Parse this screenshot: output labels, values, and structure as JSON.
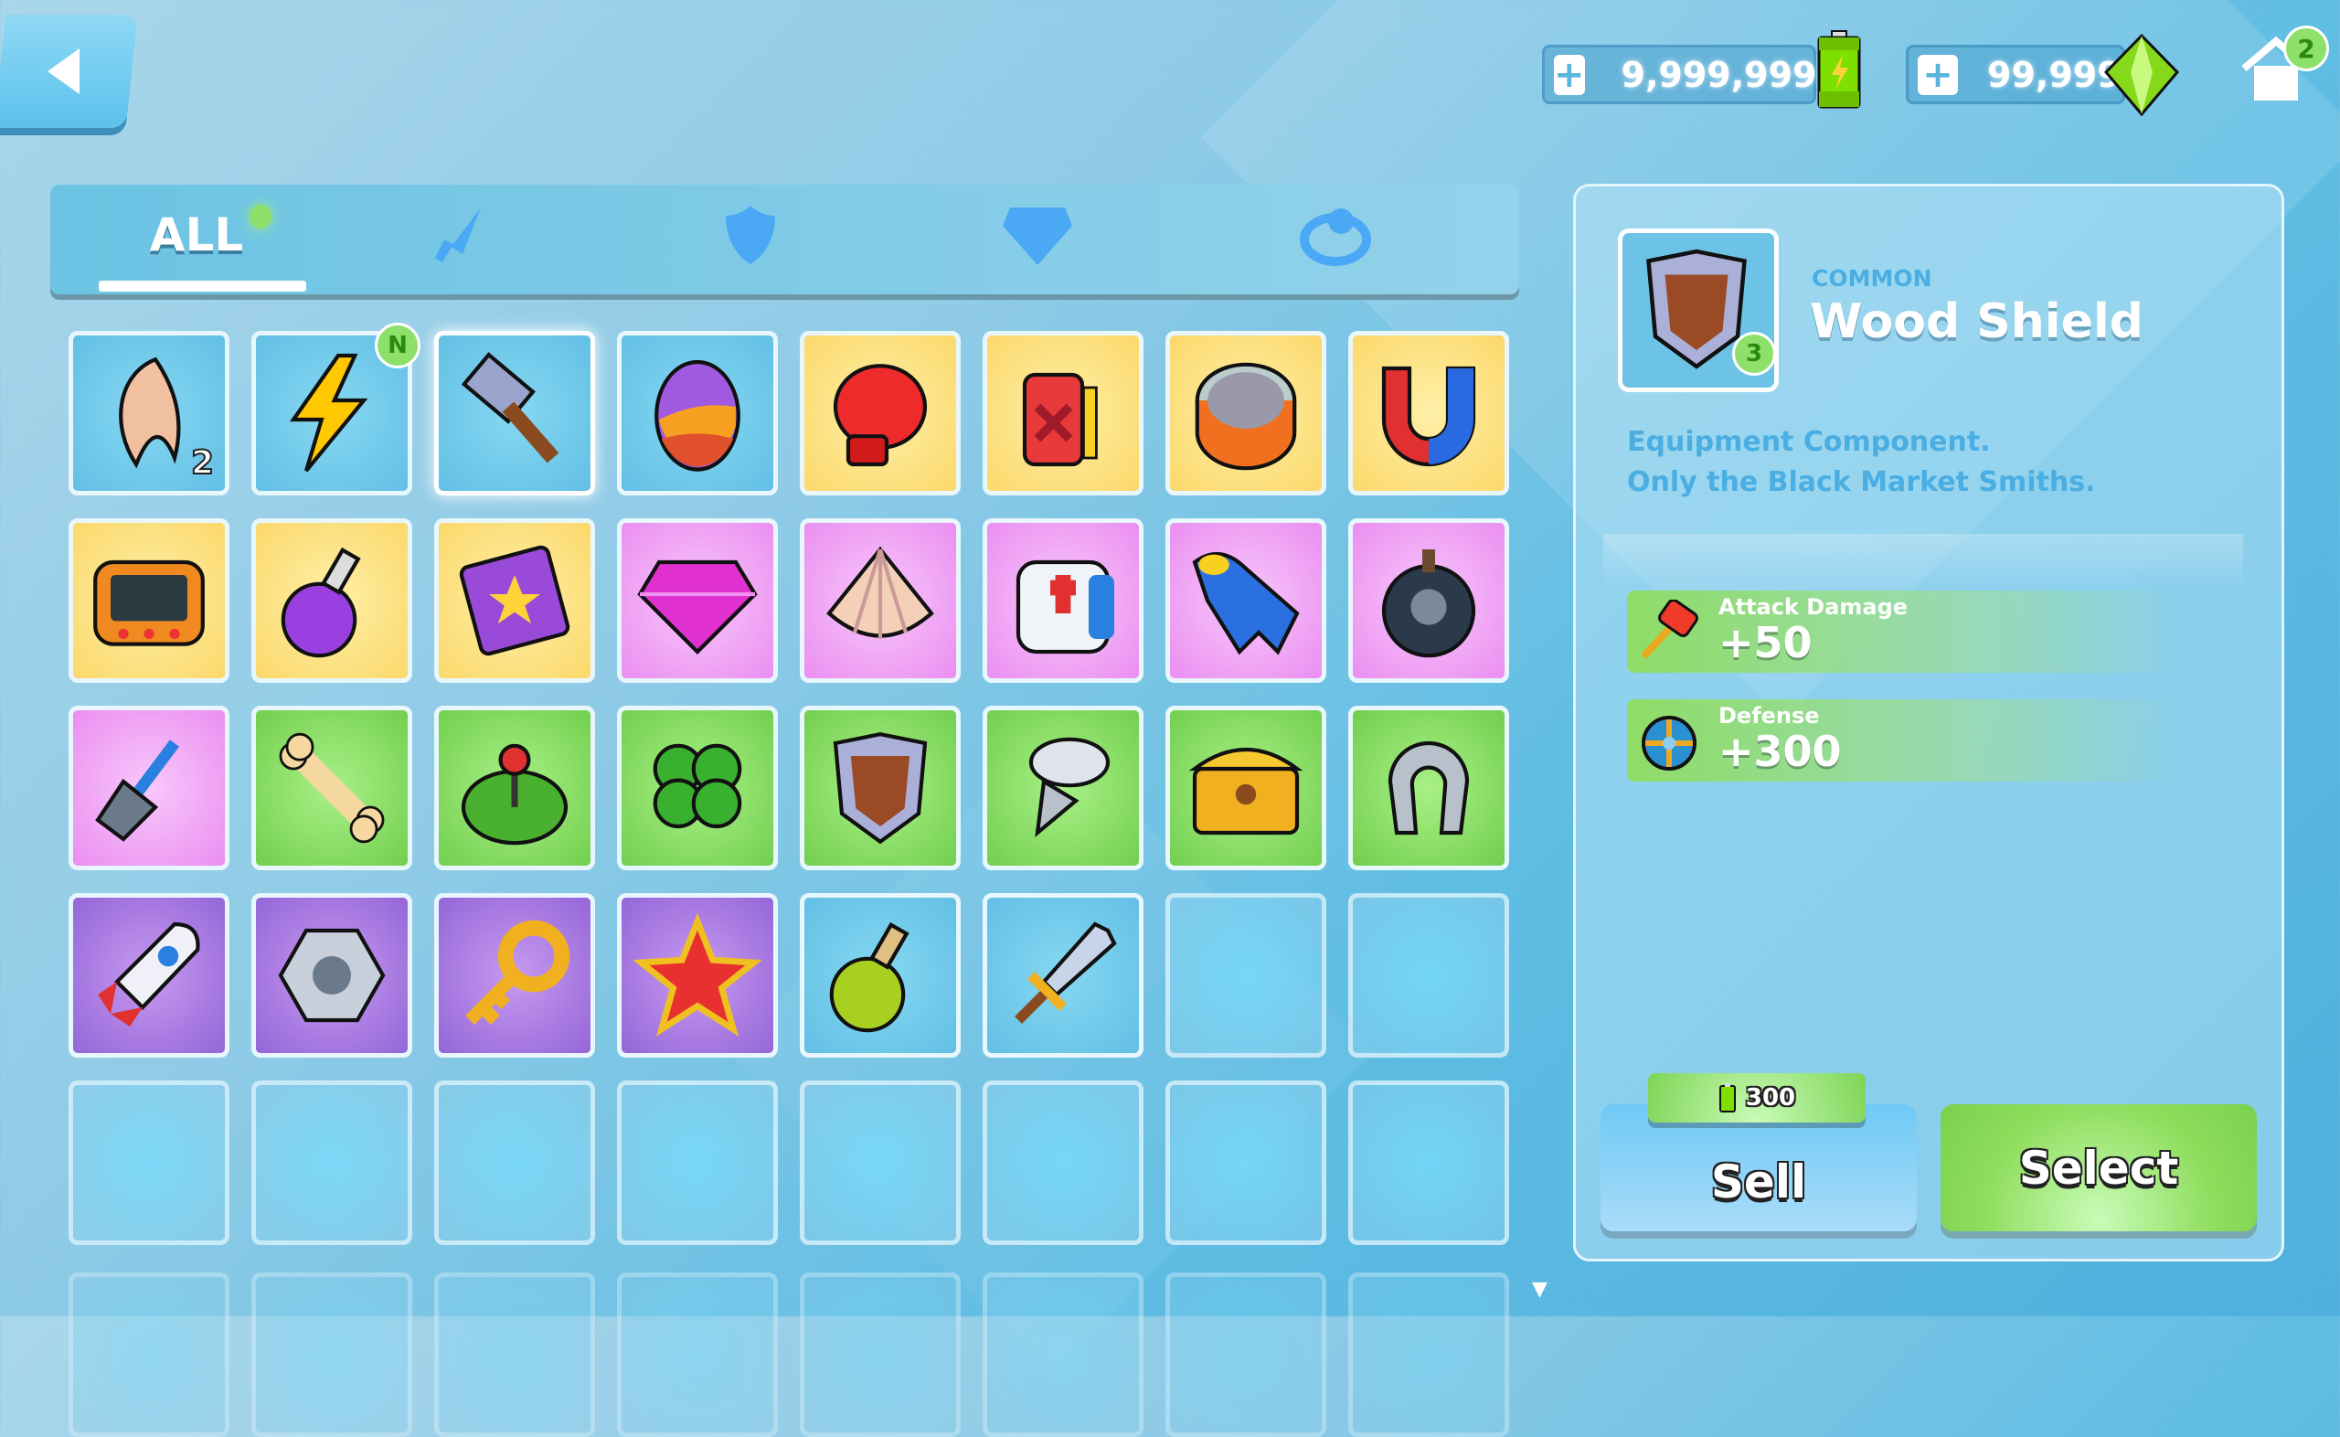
{
  "header": {
    "energy": "9,999,999",
    "gems": "99,999",
    "home_badge": "2"
  },
  "tabs": [
    {
      "label": "ALL",
      "icon": "all"
    },
    {
      "icon": "sword-icon"
    },
    {
      "icon": "shield-icon"
    },
    {
      "icon": "gem-icon"
    },
    {
      "icon": "ring-icon"
    }
  ],
  "grid": [
    [
      {
        "icon": "fang",
        "bg": "blue",
        "qty": "2"
      },
      {
        "icon": "lightning",
        "bg": "blue",
        "badge": "N"
      },
      {
        "icon": "hammer",
        "bg": "blue",
        "selected": true
      },
      {
        "icon": "rainbow-egg",
        "bg": "blue"
      },
      {
        "icon": "boxing-glove",
        "bg": "yellow"
      },
      {
        "icon": "fuel-can",
        "bg": "yellow"
      },
      {
        "icon": "tin-can",
        "bg": "yellow"
      },
      {
        "icon": "magnet",
        "bg": "yellow"
      }
    ],
    [
      {
        "icon": "handheld-console",
        "bg": "yellow"
      },
      {
        "icon": "potion-purple",
        "bg": "yellow"
      },
      {
        "icon": "spell-book",
        "bg": "yellow"
      },
      {
        "icon": "diamond",
        "bg": "pink"
      },
      {
        "icon": "seashell",
        "bg": "pink"
      },
      {
        "icon": "medkit-backpack",
        "bg": "pink"
      },
      {
        "icon": "flipper",
        "bg": "pink"
      },
      {
        "icon": "skull-bomb",
        "bg": "pink"
      }
    ],
    [
      {
        "icon": "shovel",
        "bg": "pink"
      },
      {
        "icon": "bone",
        "bg": "green"
      },
      {
        "icon": "joystick",
        "bg": "green"
      },
      {
        "icon": "clover",
        "bg": "green"
      },
      {
        "icon": "wood-shield",
        "bg": "green"
      },
      {
        "icon": "screw",
        "bg": "green"
      },
      {
        "icon": "treasure-chest",
        "bg": "green"
      },
      {
        "icon": "horseshoe",
        "bg": "green"
      }
    ],
    [
      {
        "icon": "rocket",
        "bg": "purple"
      },
      {
        "icon": "hex-nut",
        "bg": "purple"
      },
      {
        "icon": "golden-key",
        "bg": "purple"
      },
      {
        "icon": "star",
        "bg": "purple"
      },
      {
        "icon": "potion-green",
        "bg": "blue"
      },
      {
        "icon": "sword",
        "bg": "blue"
      },
      {
        "bg": "empty"
      },
      {
        "bg": "empty"
      }
    ],
    [
      {
        "bg": "empty"
      },
      {
        "bg": "empty"
      },
      {
        "bg": "empty"
      },
      {
        "bg": "empty"
      },
      {
        "bg": "empty"
      },
      {
        "bg": "empty"
      },
      {
        "bg": "empty"
      },
      {
        "bg": "empty"
      }
    ]
  ],
  "detail": {
    "rarity": "COMMON",
    "name": "Wood Shield",
    "level": "3",
    "description": [
      "Equipment Component.",
      "Only the Black Market Smiths."
    ],
    "stats": [
      {
        "label": "Attack Damage",
        "value": "+50",
        "icon": "red-hammer"
      },
      {
        "label": "Defense",
        "value": "+300",
        "icon": "round-shield"
      }
    ],
    "sell_price": "300",
    "sell_label": "Sell",
    "select_label": "Select"
  },
  "colors": {
    "blue": "#6cc3e6",
    "yellow": "#fbd86a",
    "pink": "#ea8ef0",
    "green": "#72cf4e",
    "purple": "#9466d8",
    "accent_green": "#8de06a"
  }
}
